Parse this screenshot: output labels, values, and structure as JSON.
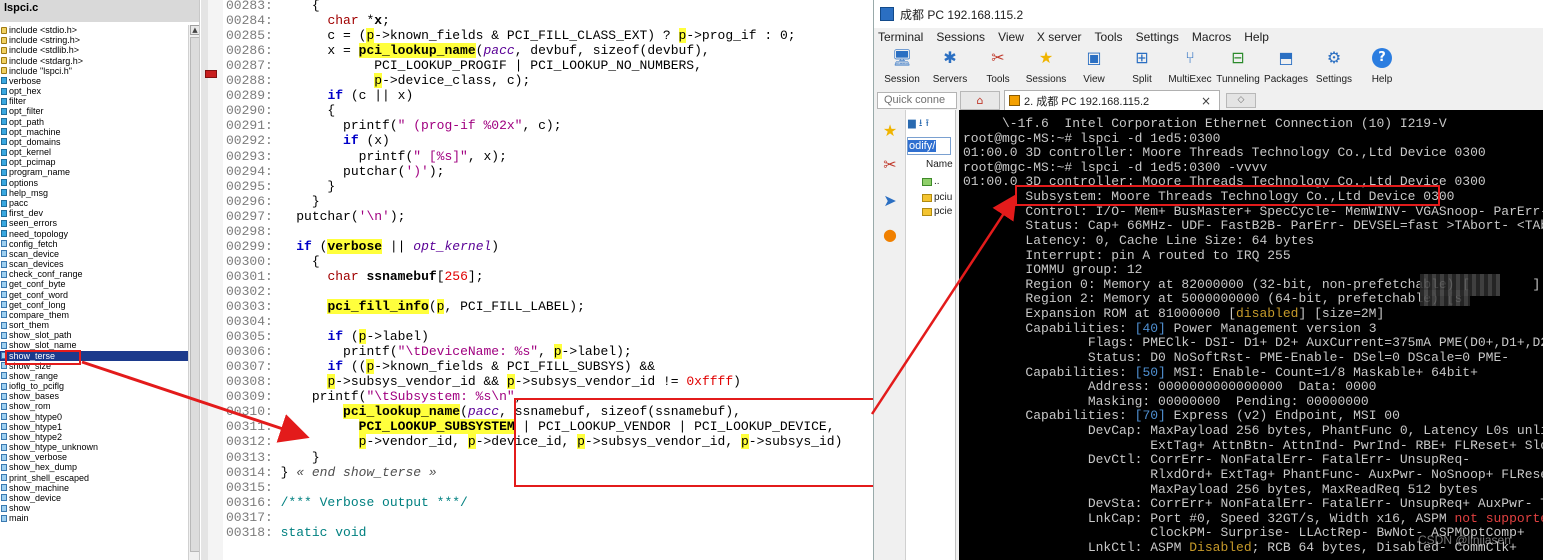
{
  "symbol_panel": {
    "title": "lspci.c",
    "items": [
      {
        "label": "include <stdio.h>",
        "kind": "inc"
      },
      {
        "label": "include <string.h>",
        "kind": "inc"
      },
      {
        "label": "include <stdlib.h>",
        "kind": "inc"
      },
      {
        "label": "include <stdarg.h>",
        "kind": "inc"
      },
      {
        "label": "include \"lspci.h\"",
        "kind": "inc"
      },
      {
        "label": "verbose",
        "kind": "var"
      },
      {
        "label": "opt_hex",
        "kind": "var"
      },
      {
        "label": "filter",
        "kind": "var"
      },
      {
        "label": "opt_filter",
        "kind": "var"
      },
      {
        "label": "opt_path",
        "kind": "var"
      },
      {
        "label": "opt_machine",
        "kind": "var"
      },
      {
        "label": "opt_domains",
        "kind": "var"
      },
      {
        "label": "opt_kernel",
        "kind": "var"
      },
      {
        "label": "opt_pcimap",
        "kind": "var"
      },
      {
        "label": "program_name",
        "kind": "var"
      },
      {
        "label": "options",
        "kind": "var"
      },
      {
        "label": "help_msg",
        "kind": "var"
      },
      {
        "label": "pacc",
        "kind": "var"
      },
      {
        "label": "first_dev",
        "kind": "var"
      },
      {
        "label": "seen_errors",
        "kind": "var"
      },
      {
        "label": "need_topology",
        "kind": "var"
      },
      {
        "label": "config_fetch",
        "kind": "fn"
      },
      {
        "label": "scan_device",
        "kind": "fn"
      },
      {
        "label": "scan_devices",
        "kind": "fn"
      },
      {
        "label": "check_conf_range",
        "kind": "fn"
      },
      {
        "label": "get_conf_byte",
        "kind": "fn"
      },
      {
        "label": "get_conf_word",
        "kind": "fn"
      },
      {
        "label": "get_conf_long",
        "kind": "fn"
      },
      {
        "label": "compare_them",
        "kind": "fn"
      },
      {
        "label": "sort_them",
        "kind": "fn"
      },
      {
        "label": "show_slot_path",
        "kind": "fn"
      },
      {
        "label": "show_slot_name",
        "kind": "fn"
      },
      {
        "label": "show_terse",
        "kind": "fn"
      },
      {
        "label": "show_size",
        "kind": "fn"
      },
      {
        "label": "show_range",
        "kind": "fn"
      },
      {
        "label": "ioflg_to_pciflg",
        "kind": "fn"
      },
      {
        "label": "show_bases",
        "kind": "fn"
      },
      {
        "label": "show_rom",
        "kind": "fn"
      },
      {
        "label": "show_htype0",
        "kind": "fn"
      },
      {
        "label": "show_htype1",
        "kind": "fn"
      },
      {
        "label": "show_htype2",
        "kind": "fn"
      },
      {
        "label": "show_htype_unknown",
        "kind": "fn"
      },
      {
        "label": "show_verbose",
        "kind": "fn"
      },
      {
        "label": "show_hex_dump",
        "kind": "fn"
      },
      {
        "label": "print_shell_escaped",
        "kind": "fn"
      },
      {
        "label": "show_machine",
        "kind": "fn"
      },
      {
        "label": "show_device",
        "kind": "fn"
      },
      {
        "label": "show",
        "kind": "fn"
      },
      {
        "label": "main",
        "kind": "fn"
      }
    ],
    "selected": "show_terse"
  },
  "editor": {
    "lines": [
      {
        "num": "00283:",
        "segs": [
          [
            "",
            "    "
          ],
          [
            "pu",
            "{"
          ]
        ]
      },
      {
        "num": "00284:",
        "segs": [
          [
            "",
            "      "
          ],
          [
            "ty",
            "char"
          ],
          [
            "",
            " *"
          ],
          [
            "kb",
            "x"
          ],
          [
            "",
            ";"
          ]
        ]
      },
      {
        "num": "00285:",
        "segs": [
          [
            "",
            "      c = ("
          ],
          [
            "vr",
            "p"
          ],
          [
            "",
            "->known_fields & PCI_FILL_CLASS_EXT) ? "
          ],
          [
            "vr",
            "p"
          ],
          [
            "",
            "->prog_if : 0;"
          ]
        ]
      },
      {
        "num": "00286:",
        "segs": [
          [
            "",
            "      x = "
          ],
          [
            "fn",
            "pci_lookup_name"
          ],
          [
            "",
            "("
          ],
          [
            "pa",
            "pacc"
          ],
          [
            "",
            ", devbuf, sizeof(devbuf),"
          ]
        ]
      },
      {
        "num": "00287:",
        "segs": [
          [
            "",
            "            PCI_LOOKUP_PROGIF | PCI_LOOKUP_NO_NUMBERS,"
          ]
        ]
      },
      {
        "num": "00288:",
        "segs": [
          [
            "",
            "            "
          ],
          [
            "vr",
            "p"
          ],
          [
            "",
            "->device_class, c);"
          ]
        ]
      },
      {
        "num": "00289:",
        "segs": [
          [
            "",
            "      "
          ],
          [
            "kw",
            "if"
          ],
          [
            "",
            " (c || x)"
          ]
        ]
      },
      {
        "num": "00290:",
        "segs": [
          [
            "",
            "      {"
          ]
        ]
      },
      {
        "num": "00291:",
        "segs": [
          [
            "",
            "        printf("
          ],
          [
            "st",
            "\" (prog-if %02x\""
          ],
          [
            "",
            ", c);"
          ]
        ]
      },
      {
        "num": "00292:",
        "segs": [
          [
            "",
            "        "
          ],
          [
            "kw",
            "if"
          ],
          [
            "",
            " (x)"
          ]
        ]
      },
      {
        "num": "00293:",
        "segs": [
          [
            "",
            "          printf("
          ],
          [
            "st",
            "\" [%s]\""
          ],
          [
            "",
            ", x);"
          ]
        ]
      },
      {
        "num": "00294:",
        "segs": [
          [
            "",
            "        putchar("
          ],
          [
            "st",
            "')'"
          ],
          [
            "",
            ");"
          ]
        ]
      },
      {
        "num": "00295:",
        "segs": [
          [
            "",
            "      }"
          ]
        ]
      },
      {
        "num": "00296:",
        "segs": [
          [
            "",
            "    }"
          ]
        ]
      },
      {
        "num": "00297:",
        "segs": [
          [
            "",
            "  putchar("
          ],
          [
            "st",
            "'\\n'"
          ],
          [
            "",
            ");"
          ]
        ]
      },
      {
        "num": "00298:",
        "segs": [
          [
            "",
            ""
          ]
        ]
      },
      {
        "num": "00299:",
        "segs": [
          [
            "",
            "  "
          ],
          [
            "kw",
            "if"
          ],
          [
            "",
            " ("
          ],
          [
            "vb",
            "verbose"
          ],
          [
            "",
            " || "
          ],
          [
            "pa",
            "opt_kernel"
          ],
          [
            "",
            ")"
          ]
        ]
      },
      {
        "num": "00300:",
        "segs": [
          [
            "",
            "    {"
          ]
        ]
      },
      {
        "num": "00301:",
        "segs": [
          [
            "",
            "      "
          ],
          [
            "ty",
            "char"
          ],
          [
            "",
            " "
          ],
          [
            "kb",
            "ssnamebuf"
          ],
          [
            "",
            "["
          ],
          [
            "nm",
            "256"
          ],
          [
            "",
            "];"
          ]
        ]
      },
      {
        "num": "00302:",
        "segs": [
          [
            "",
            ""
          ]
        ]
      },
      {
        "num": "00303:",
        "segs": [
          [
            "",
            "      "
          ],
          [
            "fn",
            "pci_fill_info"
          ],
          [
            "",
            "("
          ],
          [
            "vr",
            "p"
          ],
          [
            "",
            ", PCI_FILL_LABEL);"
          ]
        ]
      },
      {
        "num": "00304:",
        "segs": [
          [
            "",
            ""
          ]
        ]
      },
      {
        "num": "00305:",
        "segs": [
          [
            "",
            "      "
          ],
          [
            "kw",
            "if"
          ],
          [
            "",
            " ("
          ],
          [
            "vr",
            "p"
          ],
          [
            "",
            "->label)"
          ]
        ]
      },
      {
        "num": "00306:",
        "segs": [
          [
            "",
            "        printf("
          ],
          [
            "st",
            "\"\\tDeviceName: %s\""
          ],
          [
            "",
            ", "
          ],
          [
            "vr",
            "p"
          ],
          [
            "",
            "->label);"
          ]
        ]
      },
      {
        "num": "00307:",
        "segs": [
          [
            "",
            "      "
          ],
          [
            "kw",
            "if"
          ],
          [
            "",
            " (("
          ],
          [
            "vr",
            "p"
          ],
          [
            "",
            "->known_fields & PCI_FILL_SUBSYS) &&"
          ]
        ]
      },
      {
        "num": "00308:",
        "segs": [
          [
            "",
            "      "
          ],
          [
            "vr",
            "p"
          ],
          [
            "",
            "->subsys_vendor_id && "
          ],
          [
            "vr",
            "p"
          ],
          [
            "",
            "->subsys_vendor_id != "
          ],
          [
            "nm",
            "0xffff"
          ],
          [
            "",
            ")"
          ]
        ]
      },
      {
        "num": "00309:",
        "segs": [
          [
            "",
            "    printf("
          ],
          [
            "st",
            "\"\\tSubsystem: %s\\n\""
          ],
          [
            "",
            ","
          ]
        ]
      },
      {
        "num": "00310:",
        "segs": [
          [
            "",
            "        "
          ],
          [
            "fn",
            "pci_lookup_name"
          ],
          [
            "",
            "("
          ],
          [
            "pa",
            "pacc"
          ],
          [
            "",
            ", ssnamebuf, sizeof(ssnamebuf),"
          ]
        ]
      },
      {
        "num": "00311:",
        "segs": [
          [
            "",
            "          "
          ],
          [
            "fn",
            "PCI_LOOKUP_SUBSYSTEM"
          ],
          [
            "",
            " | PCI_LOOKUP_VENDOR | PCI_LOOKUP_DEVICE,"
          ]
        ]
      },
      {
        "num": "00312:",
        "segs": [
          [
            "",
            "          "
          ],
          [
            "vr",
            "p"
          ],
          [
            "",
            "->vendor_id, "
          ],
          [
            "vr",
            "p"
          ],
          [
            "",
            "->device_id, "
          ],
          [
            "vr",
            "p"
          ],
          [
            "",
            "->subsys_vendor_id, "
          ],
          [
            "vr",
            "p"
          ],
          [
            "",
            "->subsys_id)"
          ]
        ]
      },
      {
        "num": "00313:",
        "segs": [
          [
            "",
            "    }"
          ]
        ]
      },
      {
        "num": "00314:",
        "segs": [
          [
            "",
            "} "
          ],
          [
            "cm",
            "« end show_terse »"
          ]
        ]
      },
      {
        "num": "00315:",
        "segs": [
          [
            "",
            ""
          ]
        ]
      },
      {
        "num": "00316:",
        "segs": [
          [
            "",
            ""
          ],
          [
            "mc",
            "/*** Verbose output ***/"
          ]
        ]
      },
      {
        "num": "00317:",
        "segs": [
          [
            "",
            ""
          ]
        ]
      },
      {
        "num": "00318:",
        "segs": [
          [
            "",
            ""
          ],
          [
            "mc",
            "static void"
          ]
        ]
      }
    ]
  },
  "moba": {
    "title": "成都 PC 192.168.115.2",
    "menu": [
      "Terminal",
      "Sessions",
      "View",
      "X server",
      "Tools",
      "Settings",
      "Macros",
      "Help"
    ],
    "toolbar": [
      {
        "label": "Session",
        "icon": "session-icon",
        "glyph": "🖥",
        "color": "#2b6fc2"
      },
      {
        "label": "Servers",
        "icon": "servers-icon",
        "glyph": "✱",
        "color": "#2b6fc2"
      },
      {
        "label": "Tools",
        "icon": "tools-icon",
        "glyph": "✂",
        "color": "#c0392b"
      },
      {
        "label": "Sessions",
        "icon": "sessions-star-icon",
        "glyph": "★",
        "color": "#f0b400"
      },
      {
        "label": "View",
        "icon": "view-icon",
        "glyph": "▣",
        "color": "#2b6fc2"
      },
      {
        "label": "Split",
        "icon": "split-icon",
        "glyph": "⊞",
        "color": "#2b6fc2"
      },
      {
        "label": "MultiExec",
        "icon": "multiexec-icon",
        "glyph": "⑂",
        "color": "#2b6fc2"
      },
      {
        "label": "Tunneling",
        "icon": "tunneling-icon",
        "glyph": "⊟",
        "color": "#2a8a2a"
      },
      {
        "label": "Packages",
        "icon": "packages-icon",
        "glyph": "⬒",
        "color": "#2b6fc2"
      },
      {
        "label": "Settings",
        "icon": "settings-icon",
        "glyph": "⚙",
        "color": "#2b6fc2"
      },
      {
        "label": "Help",
        "icon": "help-icon",
        "glyph": "?",
        "color": "#ffffff"
      }
    ],
    "quick_connect": "Quick conne",
    "tab_label": "2. 成都 PC 192.168.115.2",
    "sftp": {
      "path_value": "odify/",
      "col_name": "Name",
      "files": [
        "..",
        "pciu",
        "pcie"
      ]
    },
    "terminal": [
      [
        [
          "tg",
          "     \\-1f.6  Intel Corporation Ethernet Connection (10) I219-V"
        ]
      ],
      [
        [
          "tg",
          "root@mgc-MS:~# lspci -d 1ed5:0300"
        ]
      ],
      [
        [
          "tg",
          "01:00.0 3D controller: Moore Threads Technology Co.,Ltd Device 0300"
        ]
      ],
      [
        [
          "tg",
          "root@mgc-MS:~# lspci -d 1ed5:0300 -vvvv"
        ]
      ],
      [
        [
          "tg",
          "01:00.0 3D controller: Moore Threads Technology Co.,Ltd Device 0300"
        ]
      ],
      [
        [
          "tg",
          "        Subsystem: Moore Threads Technology Co.,Ltd Device 0300"
        ]
      ],
      [
        [
          "tg",
          "        Control: I/O- Mem+ BusMaster+ SpecCycle- MemWINV- VGASnoop- ParErr- Step"
        ]
      ],
      [
        [
          "tg",
          "        Status: Cap+ 66MHz- UDF- FastB2B- ParErr- DEVSEL=fast >TAbort- <TAbort-"
        ]
      ],
      [
        [
          "tg",
          "        Latency: 0, Cache Line Size: 64 bytes"
        ]
      ],
      [
        [
          "tg",
          "        Interrupt: pin A routed to IRQ 255"
        ]
      ],
      [
        [
          "tg",
          "        IOMMU group: 12"
        ]
      ],
      [
        [
          "tg",
          "        Region 0: Memory at 82000000 (32-bit, non-prefetchable) ["
        ],
        [
          "tg",
          "        ]"
        ]
      ],
      [
        [
          "tg",
          "        Region 2: Memory at 5000000000 (64-bit, prefetchable) [s"
        ]
      ],
      [
        [
          "tg",
          "        Expansion ROM at 81000000 ["
        ],
        [
          "ty",
          "disabled"
        ],
        [
          "tg",
          "] [size=2M]"
        ]
      ],
      [
        [
          "tg",
          "        Capabilities: "
        ],
        [
          "tb",
          "[40]"
        ],
        [
          "tg",
          " Power Management version 3"
        ]
      ],
      [
        [
          "tg",
          "                Flags: PMEClk- DSI- D1+ D2+ AuxCurrent=375mA PME(D0+,D1+,D2-,D3h"
        ]
      ],
      [
        [
          "tg",
          "                Status: D0 NoSoftRst- PME-Enable- DSel=0 DScale=0 PME-"
        ]
      ],
      [
        [
          "tg",
          "        Capabilities: "
        ],
        [
          "tb",
          "[50]"
        ],
        [
          "tg",
          " MSI: Enable- Count=1/8 Maskable+ 64bit+"
        ]
      ],
      [
        [
          "tg",
          "                Address: 0000000000000000  Data: 0000"
        ]
      ],
      [
        [
          "tg",
          "                Masking: 00000000  Pending: 00000000"
        ]
      ],
      [
        [
          "tg",
          "        Capabilities: "
        ],
        [
          "tb",
          "[70]"
        ],
        [
          "tg",
          " Express (v2) Endpoint, MSI 00"
        ]
      ],
      [
        [
          "tg",
          "                DevCap: MaxPayload 256 bytes, PhantFunc 0, Latency L0s unlimited"
        ]
      ],
      [
        [
          "tg",
          "                        ExtTag+ AttnBtn- AttnInd- PwrInd- RBE+ FLReset+ SlotPowe"
        ]
      ],
      [
        [
          "tg",
          "                DevCtl: CorrErr- NonFatalErr- FatalErr- UnsupReq-"
        ]
      ],
      [
        [
          "tg",
          "                        RlxdOrd+ ExtTag+ PhantFunc- AuxPwr- NoSnoop+ FLReset-"
        ]
      ],
      [
        [
          "tg",
          "                        MaxPayload 256 bytes, MaxReadReq 512 bytes"
        ]
      ],
      [
        [
          "tg",
          "                DevSta: CorrErr+ NonFatalErr- FatalErr- UnsupReq+ AuxPwr- TransP"
        ]
      ],
      [
        [
          "tg",
          "                LnkCap: Port #0, Speed 32GT/s, Width x16, ASPM "
        ],
        [
          "tr",
          "not supported"
        ]
      ],
      [
        [
          "tg",
          "                        ClockPM- Surprise- LLActRep- BwNot- ASPMOptComp+"
        ]
      ],
      [
        [
          "tg",
          "                LnkCtl: ASPM "
        ],
        [
          "ty",
          "Disabled"
        ],
        [
          "tg",
          "; RCB 64 bytes, Disabled- CommClk+"
        ]
      ]
    ],
    "watermark": "CSDN @linjiasen"
  }
}
